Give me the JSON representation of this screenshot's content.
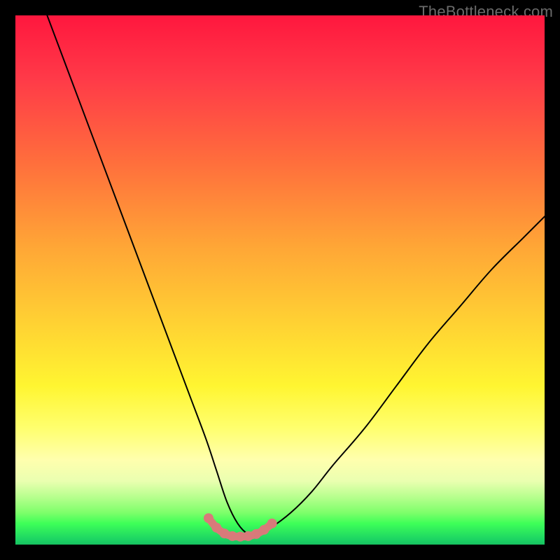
{
  "watermark": {
    "text": "TheBottleneck.com"
  },
  "chart_data": {
    "type": "line",
    "title": "",
    "xlabel": "",
    "ylabel": "",
    "xlim": [
      0,
      100
    ],
    "ylim": [
      0,
      100
    ],
    "series": [
      {
        "name": "bottleneck-curve",
        "x": [
          6,
          9,
          12,
          15,
          18,
          21,
          24,
          27,
          30,
          33,
          36,
          38,
          40,
          42,
          44,
          46,
          48,
          52,
          56,
          60,
          66,
          72,
          78,
          84,
          90,
          96,
          100
        ],
        "y": [
          100,
          92,
          84,
          76,
          68,
          60,
          52,
          44,
          36,
          28,
          20,
          14,
          8,
          4,
          2,
          2,
          3,
          6,
          10,
          15,
          22,
          30,
          38,
          45,
          52,
          58,
          62
        ]
      }
    ],
    "valley_marker": {
      "name": "valley-highlight",
      "color": "#d87a7a",
      "x": [
        36.5,
        38,
        39.5,
        41,
        42.5,
        44,
        45.5,
        47,
        48.5
      ],
      "y": [
        5.0,
        3.2,
        2.1,
        1.6,
        1.5,
        1.6,
        2.0,
        2.8,
        4.0
      ]
    }
  }
}
